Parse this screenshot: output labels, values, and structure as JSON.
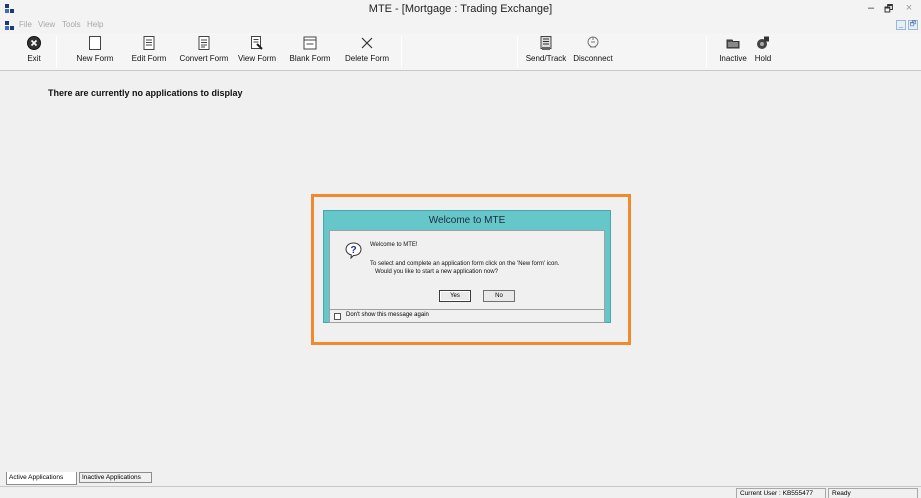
{
  "window": {
    "title": "MTE - [Mortgage : Trading Exchange]",
    "controls": {
      "minimize": "–",
      "maximize": "🗗",
      "close": "×"
    }
  },
  "menu": {
    "items": [
      "File",
      "View",
      "Tools",
      "Help"
    ],
    "mdi_controls": [
      "_",
      "🗗"
    ]
  },
  "toolbar": {
    "buttons": [
      {
        "label": "Exit",
        "icon": "exit-icon"
      },
      {
        "label": "New Form",
        "icon": "new-form-icon"
      },
      {
        "label": "Edit Form",
        "icon": "edit-form-icon"
      },
      {
        "label": "Convert Form",
        "icon": "convert-form-icon"
      },
      {
        "label": "View Form",
        "icon": "view-form-icon"
      },
      {
        "label": "Blank Form",
        "icon": "blank-form-icon"
      },
      {
        "label": "Delete Form",
        "icon": "delete-form-icon"
      },
      {
        "label": "Send/Track",
        "icon": "send-track-icon"
      },
      {
        "label": "Disconnect",
        "icon": "disconnect-icon"
      },
      {
        "label": "Inactive",
        "icon": "inactive-icon"
      },
      {
        "label": "Hold",
        "icon": "hold-icon"
      }
    ]
  },
  "main": {
    "empty_message": "There are currently no applications to display"
  },
  "dialog": {
    "title": "Welcome to MTE",
    "greeting": "Welcome to MTE!",
    "line1": "To select and complete an application form click on the 'New form' icon.",
    "line2": "Would you like to start a new application now?",
    "yes_label": "Yes",
    "no_label": "No",
    "checkbox_label": "Don't show this message again",
    "icon": "question-icon",
    "highlight_color": "#f08a2c",
    "title_bar_color": "#66c7cb"
  },
  "tabs": [
    {
      "label": "Active Applications",
      "active": true
    },
    {
      "label": "Inactive Applications",
      "active": false
    }
  ],
  "status": {
    "current_user": "Current User : KB555477",
    "state": "Ready"
  }
}
